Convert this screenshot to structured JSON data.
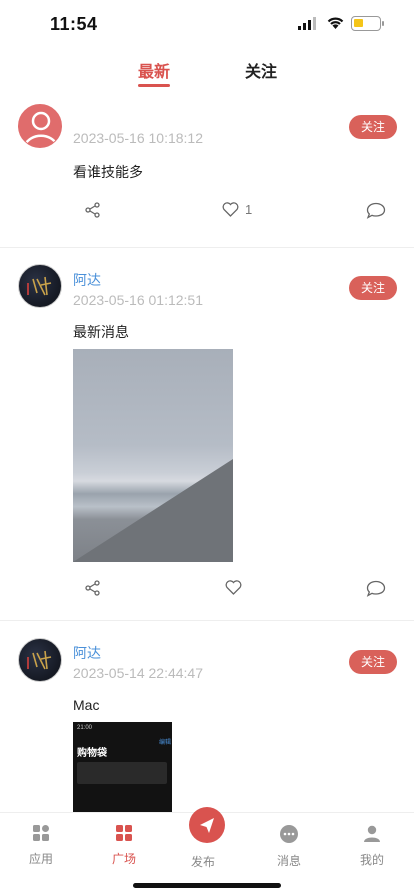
{
  "status_bar": {
    "time": "11:54"
  },
  "tabs": [
    {
      "label": "最新"
    },
    {
      "label": "关注"
    }
  ],
  "posts": [
    {
      "name": "",
      "date": "2023-05-16 10:18:12",
      "follow": "关注",
      "text": "看谁技能多",
      "likes": "1"
    },
    {
      "name": "阿达",
      "date": "2023-05-16 01:12:51",
      "follow": "关注",
      "text": "最新消息"
    },
    {
      "name": "阿达",
      "date": "2023-05-14 22:44:47",
      "follow": "关注",
      "text": "Mac",
      "image": {
        "time": "21:00",
        "title": "购物袋",
        "tag": "编辑"
      }
    }
  ],
  "tabbar": [
    {
      "label": "应用",
      "icon": "apps-icon"
    },
    {
      "label": "广场",
      "icon": "square-icon"
    },
    {
      "label": "发布",
      "icon": "send-icon"
    },
    {
      "label": "消息",
      "icon": "message-icon"
    },
    {
      "label": "我的",
      "icon": "profile-icon"
    }
  ],
  "colors": {
    "accent": "#d9534f",
    "link": "#4a90d9",
    "follow_bg": "#d9615a"
  }
}
